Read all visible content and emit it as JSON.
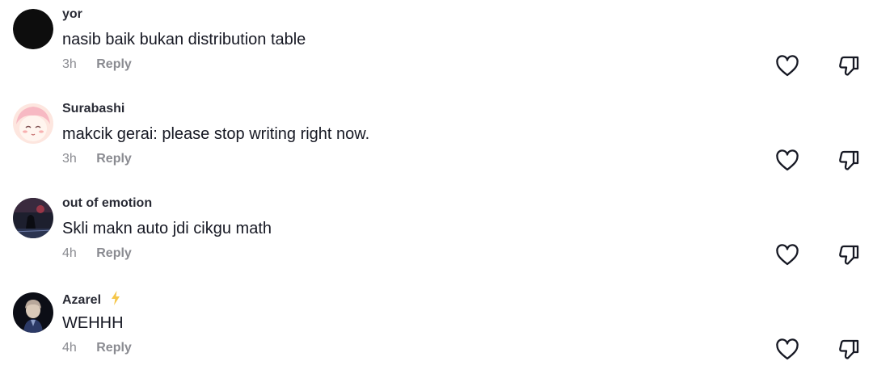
{
  "comments": [
    {
      "username": "yor",
      "text": "nasib baik bukan distribution table",
      "time": "3h",
      "reply_label": "Reply",
      "avatar": "dark-circle",
      "badge": ""
    },
    {
      "username": "Surabashi",
      "text": "makcik gerai: please stop writing right now.",
      "time": "3h",
      "reply_label": "Reply",
      "avatar": "anime-pink-hair",
      "badge": ""
    },
    {
      "username": "out of emotion",
      "text": "Skli makn auto jdi cikgu math",
      "time": "4h",
      "reply_label": "Reply",
      "avatar": "dark-night-scene",
      "badge": ""
    },
    {
      "username": "Azarel",
      "text": "WEHHH",
      "time": "4h",
      "reply_label": "Reply",
      "avatar": "anime-character-dark",
      "badge": "lightning-icon"
    }
  ],
  "colors": {
    "text": "#161823",
    "meta": "#8a8b91",
    "badge": "#f5c23a"
  },
  "icons": {
    "like": "heart-outline-icon",
    "dislike": "thumbs-down-outline-icon"
  }
}
